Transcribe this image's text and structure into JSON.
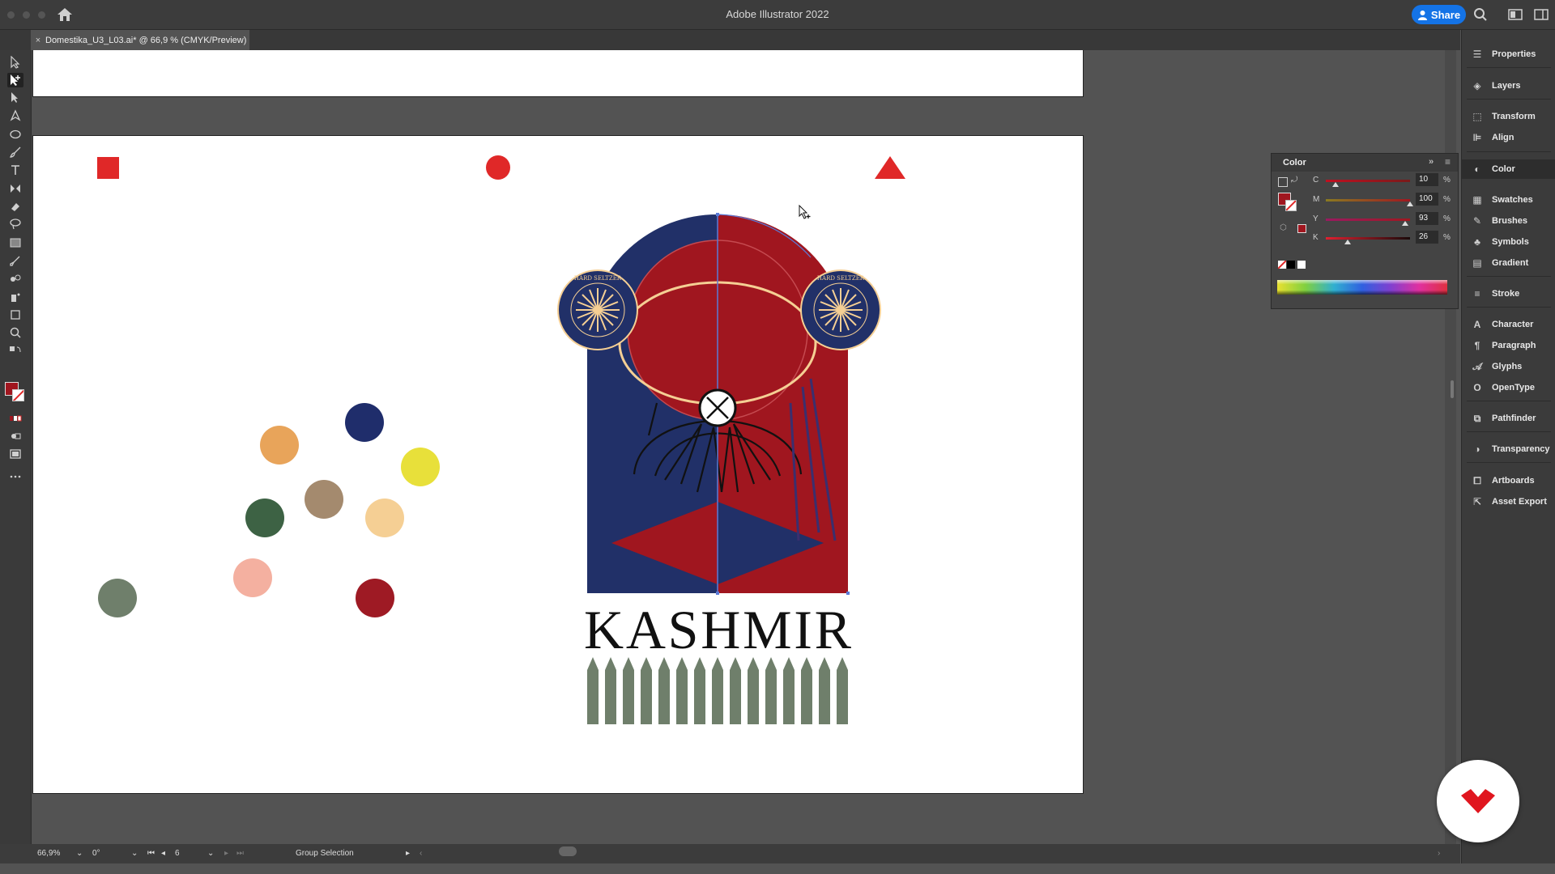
{
  "window": {
    "app_title": "Adobe Illustrator 2022",
    "share_label": "Share"
  },
  "document_tab": {
    "close": "×",
    "title": "Domestika_U3_L03.ai* @ 66,9 % (CMYK/Preview)"
  },
  "artwork": {
    "text": "KASHMIR",
    "badge_text": "HARD SELTZER",
    "palette": [
      "#e8a45a",
      "#1f2d6b",
      "#e8e03a",
      "#a48a6e",
      "#3d6244",
      "#f5cf94",
      "#f4b0a0",
      "#9e1a24",
      "#6f7f6b"
    ],
    "accent_red": "#e02828",
    "navy": "#213068",
    "crimson": "#a0161f",
    "sage": "#6f7f6b"
  },
  "status_bar": {
    "zoom": "66,9%",
    "rotation": "0°",
    "artboard": "6",
    "tool": "Group Selection"
  },
  "panels": [
    {
      "label": "Properties",
      "icon": "properties-icon"
    },
    {
      "label": "Layers",
      "icon": "layers-icon"
    },
    {
      "label": "Transform",
      "icon": "transform-icon"
    },
    {
      "label": "Align",
      "icon": "align-icon"
    },
    {
      "label": "Color",
      "icon": "color-icon"
    },
    {
      "label": "Swatches",
      "icon": "swatches-icon"
    },
    {
      "label": "Brushes",
      "icon": "brushes-icon"
    },
    {
      "label": "Symbols",
      "icon": "symbols-icon"
    },
    {
      "label": "Gradient",
      "icon": "gradient-icon"
    },
    {
      "label": "Stroke",
      "icon": "stroke-icon"
    },
    {
      "label": "Character",
      "icon": "character-icon"
    },
    {
      "label": "Paragraph",
      "icon": "paragraph-icon"
    },
    {
      "label": "Glyphs",
      "icon": "glyphs-icon"
    },
    {
      "label": "OpenType",
      "icon": "opentype-icon"
    },
    {
      "label": "Pathfinder",
      "icon": "pathfinder-icon"
    },
    {
      "label": "Transparency",
      "icon": "transparency-icon"
    },
    {
      "label": "Artboards",
      "icon": "artboards-icon"
    },
    {
      "label": "Asset Export",
      "icon": "asset-export-icon"
    }
  ],
  "color_panel": {
    "title": "Color",
    "sliders": [
      {
        "label": "C",
        "value": "10",
        "unit": "%"
      },
      {
        "label": "M",
        "value": "100",
        "unit": "%"
      },
      {
        "label": "Y",
        "value": "93",
        "unit": "%"
      },
      {
        "label": "K",
        "value": "26",
        "unit": "%"
      }
    ]
  }
}
